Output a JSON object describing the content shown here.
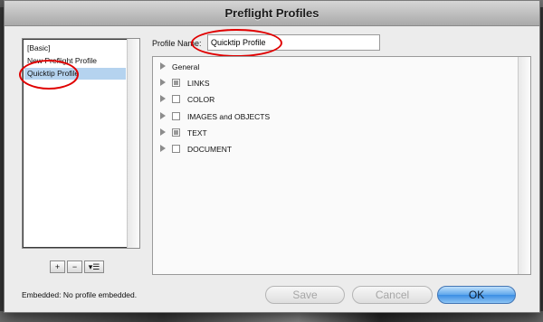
{
  "window": {
    "title": "Preflight Profiles"
  },
  "profiles": {
    "items": [
      "[Basic]",
      "New Preflight Profile",
      "Quicktip Profile"
    ],
    "selected_index": 2
  },
  "toolbar": {
    "add": "+",
    "remove": "−",
    "menu": "▾☰"
  },
  "profile_name": {
    "label": "Profile Name:",
    "value": "Quicktip Profile"
  },
  "categories": [
    {
      "label": "General",
      "checkbox": "none"
    },
    {
      "label": "LINKS",
      "checkbox": "mixed"
    },
    {
      "label": "COLOR",
      "checkbox": "unchecked"
    },
    {
      "label": "IMAGES and OBJECTS",
      "checkbox": "unchecked"
    },
    {
      "label": "TEXT",
      "checkbox": "mixed"
    },
    {
      "label": "DOCUMENT",
      "checkbox": "unchecked"
    }
  ],
  "status": {
    "embedded": "Embedded:  No profile embedded."
  },
  "buttons": {
    "save": "Save",
    "cancel": "Cancel",
    "ok": "OK"
  },
  "colors": {
    "selection": "#b5d3ef",
    "annotation": "#e00000",
    "ok_button": "#3b8ee3"
  }
}
